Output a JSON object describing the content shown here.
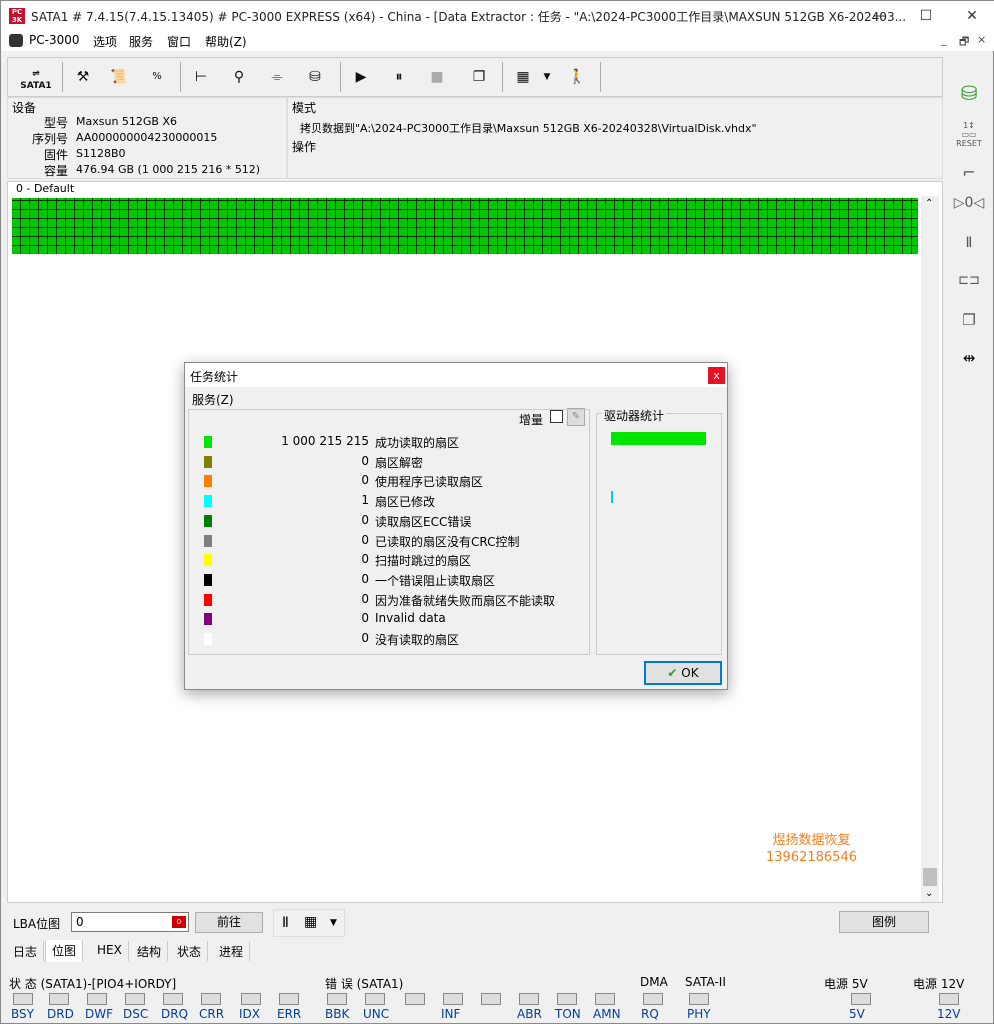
{
  "window": {
    "title": "SATA1 # 7.4.15(7.4.15.13405) # PC-3000 EXPRESS (x64) - China - [Data Extractor : 任务 - \"A:\\2024-PC3000工作目录\\MAXSUN   512GB  X6-202403...",
    "minimize": "—",
    "maximize": "☐",
    "close": "✕"
  },
  "menu": {
    "app": "PC-3000",
    "items": [
      "选项",
      "服务",
      "窗口",
      "帮助(Z)"
    ],
    "mdi_controls": [
      "_",
      "🗗",
      "×"
    ]
  },
  "toolbar": {
    "sata_label": "SATA1",
    "icons": [
      "sata-port-icon",
      "tools-icon",
      "script-icon",
      "percent-icon",
      "tree-icon",
      "binoculars-icon",
      "network-icon",
      "drive-settings-icon",
      "play-icon",
      "pause-icon",
      "stop-icon",
      "copy-windows-icon",
      "map-view-icon",
      "dropdown-icon",
      "exit-icon"
    ]
  },
  "device": {
    "section_title": "设备",
    "model_label": "型号",
    "model_value": "Maxsun  512GB  X6",
    "serial_label": "序列号",
    "serial_value": "AA000000004230000015",
    "firmware_label": "固件",
    "firmware_value": "S1128B0",
    "capacity_label": "容量",
    "capacity_value": "476.94 GB (1 000 215 216 * 512)"
  },
  "mode": {
    "section_title": "模式",
    "value": "拷贝数据到\"A:\\2024-PC3000工作目录\\Maxsun  512GB  X6-20240328\\VirtualDisk.vhdx\"",
    "operation_title": "操作"
  },
  "map": {
    "layer_label": "0 - Default",
    "fill_color": "#00c800"
  },
  "watermark": {
    "line1": "煜扬数据恢复",
    "line2": "13962186546"
  },
  "lba": {
    "label": "LBA位图",
    "value": "0",
    "go_button": "前往",
    "legend_button": "图例"
  },
  "tabs": [
    "日志",
    "位图",
    "HEX",
    "结构",
    "状态",
    "进程"
  ],
  "status": {
    "state_group": "状 态 (SATA1)-[PIO4+IORDY]",
    "error_group": "错 误 (SATA1)",
    "dma_group": "DMA",
    "sata_group": "SATA-II",
    "power5_group": "电源 5V",
    "power12_group": "电源 12V",
    "state_leds": [
      "BSY",
      "DRD",
      "DWF",
      "DSC",
      "DRQ",
      "CRR",
      "IDX",
      "ERR"
    ],
    "error_leds": [
      "BBK",
      "UNC",
      "",
      "INF",
      "",
      "ABR",
      "TON",
      "AMN"
    ],
    "dma_leds": [
      "RQ"
    ],
    "sata_leds": [
      "PHY"
    ],
    "power5_leds": [
      "5V"
    ],
    "power12_leds": [
      "12V"
    ]
  },
  "dialog": {
    "title": "任务统计",
    "close": "x",
    "menu": "服务(Z)",
    "increment_label": "增量",
    "drive_stats_label": "驱动器统计",
    "ok_label": "OK",
    "rows": [
      {
        "color": "#00e600",
        "count": "1 000 215 215",
        "desc": "成功读取的扇区"
      },
      {
        "color": "#808000",
        "count": "0",
        "desc": "扇区解密"
      },
      {
        "color": "#ff8000",
        "count": "0",
        "desc": "使用程序已读取扇区"
      },
      {
        "color": "#00ffff",
        "count": "1",
        "desc": "扇区已修改"
      },
      {
        "color": "#008000",
        "count": "0",
        "desc": "读取扇区ECC错误"
      },
      {
        "color": "#808080",
        "count": "0",
        "desc": "已读取的扇区没有CRC控制"
      },
      {
        "color": "#ffff00",
        "count": "0",
        "desc": "扫描时跳过的扇区"
      },
      {
        "color": "#000000",
        "count": "0",
        "desc": "一个错误阻止读取扇区"
      },
      {
        "color": "#ff0000",
        "count": "0",
        "desc": "因为准备就绪失败而扇区不能读取"
      },
      {
        "color": "#800080",
        "count": "0",
        "desc": "Invalid data"
      },
      {
        "color": "#ffffff",
        "count": "0",
        "desc": "没有读取的扇区"
      }
    ],
    "bar_fill_fraction": 1.0
  }
}
